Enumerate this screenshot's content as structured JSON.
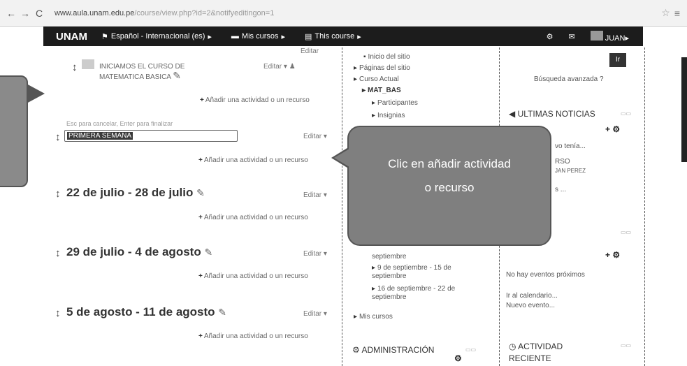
{
  "browser": {
    "back": "←",
    "forward": "→",
    "reload": "C",
    "url_main": "www.aula.unam.edu.pe",
    "url_path": "/course/view.php?id=2&notifyeditingon=1",
    "star": "☆",
    "menu": "≡"
  },
  "navbar": {
    "brand": "UNAM",
    "lang": "Español - Internacional (es)",
    "mycourses": "Mis cursos",
    "thiscourse": "This course",
    "user": "JUAN",
    "caret": "▸"
  },
  "main": {
    "edit": "Editar",
    "add_activity": "Añadir una actividad o un recurso",
    "intro_title": "INICIAMOS EL CURSO DE MATEMATICA BASICA",
    "edit_hint": "Esc para cancelar, Enter para finalizar",
    "edit_value": "PRIMERA SEMANA",
    "sections": [
      {
        "title": "22 de julio - 28 de julio"
      },
      {
        "title": "29 de julio - 4 de agosto"
      },
      {
        "title": "5 de agosto - 11 de agosto"
      }
    ]
  },
  "nav": {
    "items": [
      "Inicio del sitio",
      "Páginas del sitio",
      "Curso Actual",
      "MAT_BAS",
      "Participantes",
      "Insignias",
      "septiembre",
      "9 de septiembre - 15 de septiembre",
      "16 de septiembre - 22 de septiembre",
      "Mis cursos"
    ],
    "admin": "ADMINISTRACIÓN"
  },
  "right": {
    "go": "Ir",
    "advanced_search": "Búsqueda avanzada",
    "news_title": "ULTIMAS NOTICIAS",
    "news_fragment1": "vo tenía...",
    "news_fragment2": "RSO",
    "news_fragment3": "JAN PEREZ",
    "news_fragment4": "s ...",
    "no_events": "No hay eventos próximos",
    "calendar": "Ir al calendario...",
    "new_event": "Nuevo evento...",
    "recent_title": "ACTIVIDAD RECIENTE"
  },
  "callout": {
    "line1": "Clic en añadir actividad",
    "line2": "o recurso"
  }
}
